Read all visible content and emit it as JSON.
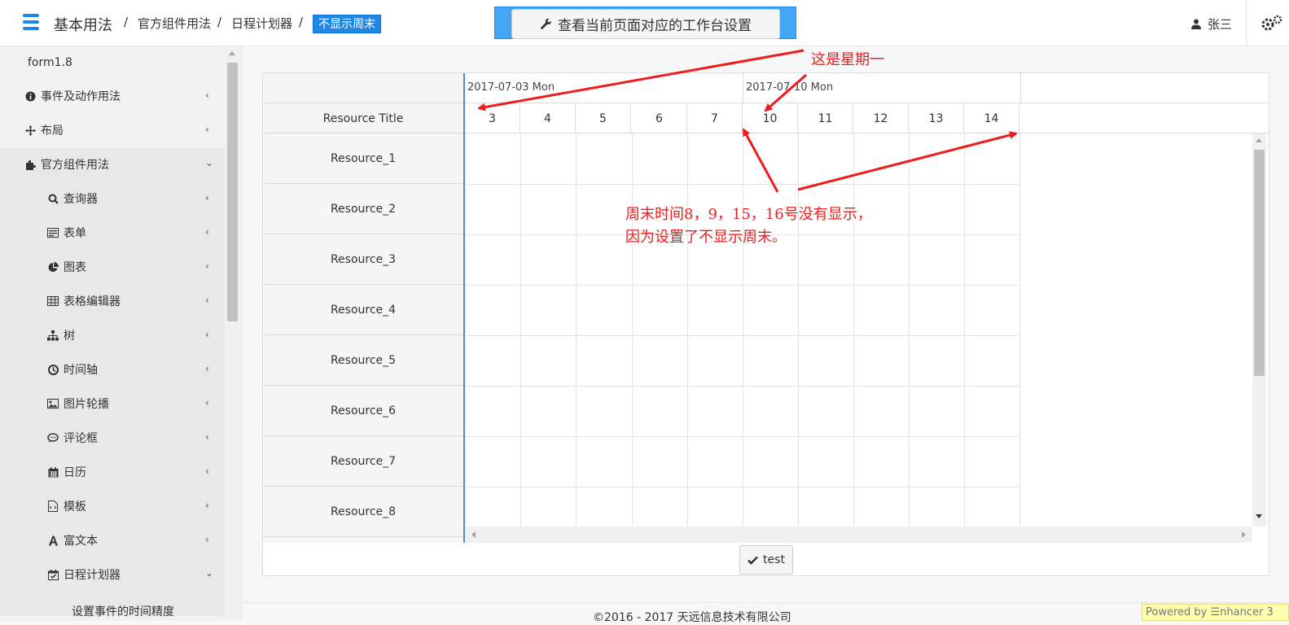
{
  "header": {
    "title": "基本用法",
    "breadcrumbs": [
      "官方组件用法",
      "日程计划器"
    ],
    "active": "不显示周末",
    "separator": "/",
    "workspace_button": "查看当前页面对应的工作台设置",
    "user": "张三"
  },
  "sidebar": {
    "top_label": "form1.8",
    "items": [
      {
        "label": "事件及动作用法",
        "icon": "info-circle-icon"
      },
      {
        "label": "布局",
        "icon": "move-icon"
      },
      {
        "label": "官方组件用法",
        "icon": "puzzle-icon"
      }
    ],
    "sub_items": [
      {
        "label": "查询器",
        "icon": "search-icon"
      },
      {
        "label": "表单",
        "icon": "form-icon"
      },
      {
        "label": "图表",
        "icon": "pie-chart-icon"
      },
      {
        "label": "表格编辑器",
        "icon": "table-icon"
      },
      {
        "label": "树",
        "icon": "sitemap-icon"
      },
      {
        "label": "时间轴",
        "icon": "clock-icon"
      },
      {
        "label": "图片轮播",
        "icon": "image-icon"
      },
      {
        "label": "评论框",
        "icon": "comment-icon"
      },
      {
        "label": "日历",
        "icon": "calendar-icon"
      },
      {
        "label": "模板",
        "icon": "file-code-icon"
      },
      {
        "label": "富文本",
        "icon": "font-icon"
      },
      {
        "label": "日程计划器",
        "icon": "calendar-check-icon"
      }
    ],
    "partial_item": "设置事件的时间精度"
  },
  "scheduler": {
    "resource_header": "Resource Title",
    "weeks": [
      "2017-07-03 Mon",
      "2017-07-10 Mon"
    ],
    "days": [
      "3",
      "4",
      "5",
      "6",
      "7",
      "10",
      "11",
      "12",
      "13",
      "14"
    ],
    "resources": [
      "Resource_1",
      "Resource_2",
      "Resource_3",
      "Resource_4",
      "Resource_5",
      "Resource_6",
      "Resource_7",
      "Resource_8"
    ]
  },
  "footer": {
    "test_button": "test",
    "copyright": "©2016 - 2017 天远信息技术有限公司",
    "powered": "Powered by ☰nhancer 3"
  },
  "annotations": {
    "monday_label": "这是星期一",
    "weekend_note_line1": "周末时间8，9，15，16号没有显示，",
    "weekend_note_line2": "因为设置了不显示周末。",
    "color": "#ee1c1c"
  }
}
